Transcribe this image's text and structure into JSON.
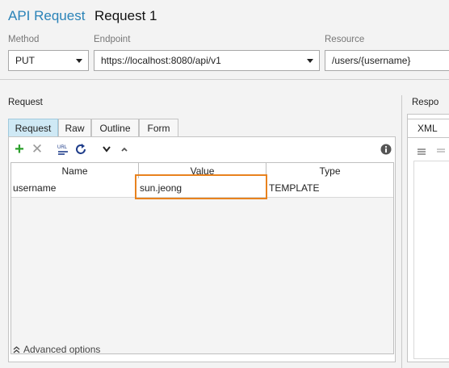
{
  "header": {
    "app_title": "API Request",
    "request_title": "Request 1"
  },
  "fields": {
    "method_label": "Method",
    "method_value": "PUT",
    "endpoint_label": "Endpoint",
    "endpoint_value": "https://localhost:8080/api/v1",
    "resource_label": "Resource",
    "resource_value": "/users/{username}"
  },
  "request": {
    "section_label": "Request",
    "tabs": [
      "Request",
      "Raw",
      "Outline",
      "Form"
    ],
    "active_tab": "Request",
    "table": {
      "columns": [
        "Name",
        "Value",
        "Type"
      ],
      "rows": [
        {
          "name": "username",
          "value": "sun.jeong",
          "type": "TEMPLATE"
        }
      ]
    },
    "advanced_options": "Advanced options"
  },
  "response": {
    "section_label": "Respo",
    "tab": "XML"
  },
  "colors": {
    "accent": "#2a83b8",
    "highlight": "#e8821e",
    "active_tab": "#cfe9f5",
    "add_icon": "#2ca02c"
  },
  "icons": [
    "add-icon",
    "remove-icon",
    "url-encode-icon",
    "refresh-icon",
    "move-down-icon",
    "move-up-icon",
    "info-icon"
  ]
}
